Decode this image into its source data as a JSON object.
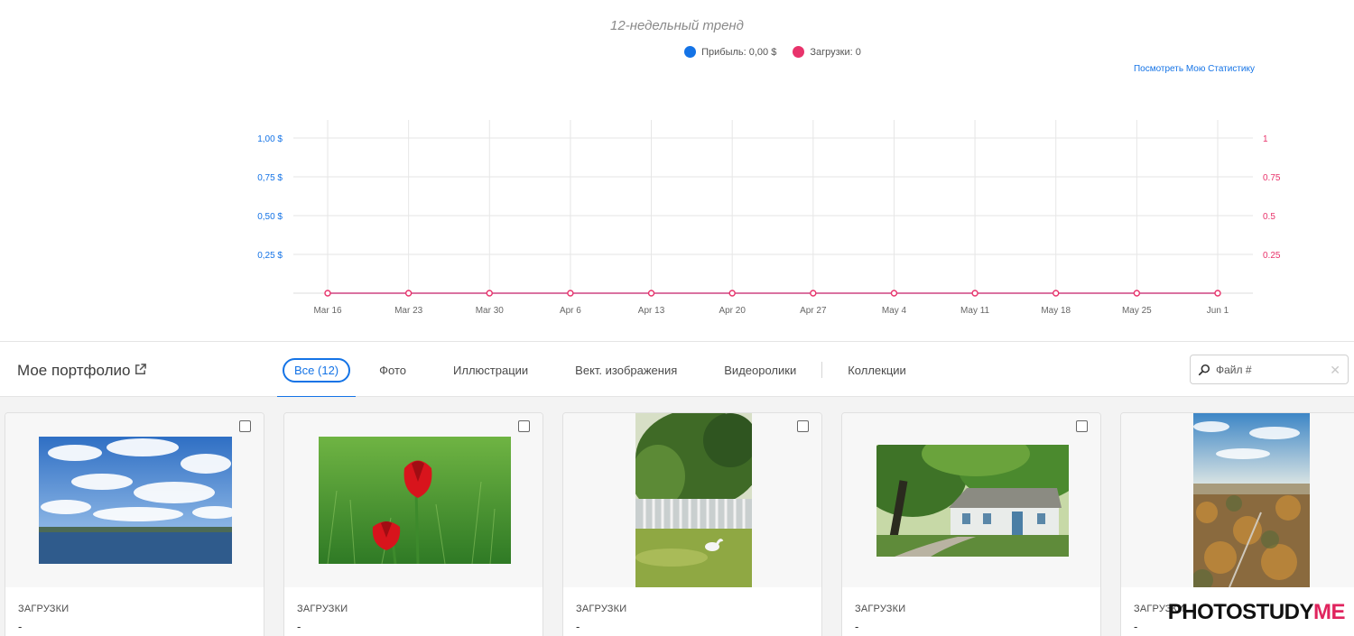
{
  "chart_section": {
    "title": "12-недельный тренд",
    "legend": [
      {
        "label": "Прибыль: 0,00 $",
        "color": "#1473e6"
      },
      {
        "label": "Загрузки: 0",
        "color": "#e8336b"
      }
    ],
    "stats_link": "Посмотреть Мою Статистику"
  },
  "chart_data": {
    "type": "line",
    "title": "12-недельный тренд",
    "x": [
      "Mar 16",
      "Mar 23",
      "Mar 30",
      "Apr 6",
      "Apr 13",
      "Apr 20",
      "Apr 27",
      "May 4",
      "May 11",
      "May 18",
      "May 25",
      "Jun 1"
    ],
    "series": [
      {
        "name": "Прибыль",
        "axis": "left",
        "color": "#1473e6",
        "values": [
          0,
          0,
          0,
          0,
          0,
          0,
          0,
          0,
          0,
          0,
          0,
          0
        ]
      },
      {
        "name": "Загрузки",
        "axis": "right",
        "color": "#e8336b",
        "values": [
          0,
          0,
          0,
          0,
          0,
          0,
          0,
          0,
          0,
          0,
          0,
          0
        ]
      }
    ],
    "y_left": {
      "ticks": [
        0.25,
        0.5,
        0.75,
        1.0
      ],
      "tick_labels": [
        "0,25 $",
        "0,50 $",
        "0,75 $",
        "1,00 $"
      ],
      "ylim": [
        0,
        1
      ]
    },
    "y_right": {
      "ticks": [
        0.25,
        0.5,
        0.75,
        1
      ],
      "tick_labels": [
        "0.25",
        "0.5",
        "0.75",
        "1"
      ],
      "ylim": [
        0,
        1
      ]
    },
    "grid": true
  },
  "portfolio": {
    "title": "Мое портфолио",
    "tabs": [
      {
        "label": "Все (12)",
        "active": true
      },
      {
        "label": "Фото"
      },
      {
        "label": "Иллюстрации"
      },
      {
        "label": "Вект. изображения"
      },
      {
        "label": "Видеоролики"
      },
      {
        "label": "Коллекции"
      }
    ],
    "search": {
      "placeholder": "Файл #"
    }
  },
  "cards": [
    {
      "label": "ЗАГРУЗКИ",
      "value": "-",
      "image": "lake-sky"
    },
    {
      "label": "ЗАГРУЗКИ",
      "value": "-",
      "image": "red-tulips"
    },
    {
      "label": "ЗАГРУЗКИ",
      "value": "-",
      "image": "goose-fence"
    },
    {
      "label": "ЗАГРУЗКИ",
      "value": "-",
      "image": "old-house"
    },
    {
      "label": "ЗАГРУЗКИ",
      "value": "-",
      "image": "aerial-town"
    }
  ],
  "watermark": {
    "main": "PHOTOSTUDY",
    "accent": "ME"
  }
}
